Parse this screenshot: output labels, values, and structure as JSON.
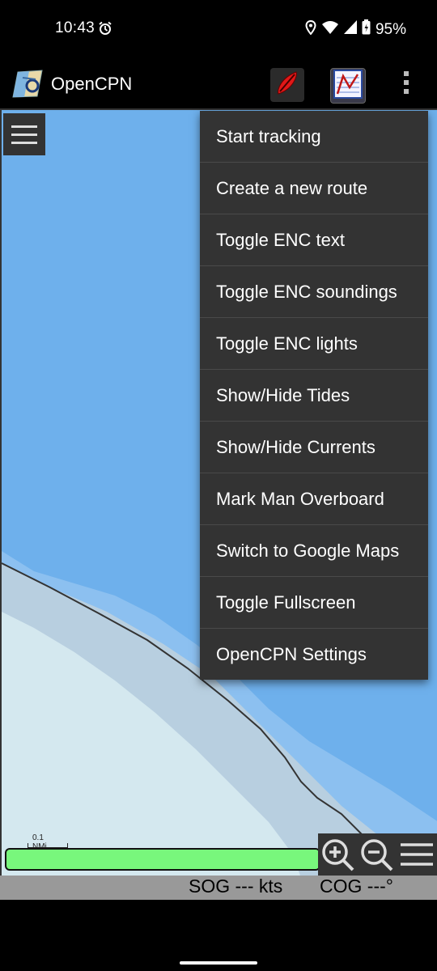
{
  "status_bar": {
    "time": "10:43",
    "battery": "95%"
  },
  "app_bar": {
    "title": "OpenCPN"
  },
  "menu": {
    "items": [
      "Start tracking",
      "Create a new route",
      "Toggle ENC text",
      "Toggle ENC soundings",
      "Toggle ENC lights",
      "Show/Hide Tides",
      "Show/Hide Currents",
      "Mark Man Overboard",
      "Switch to Google Maps",
      "Toggle Fullscreen",
      "OpenCPN Settings"
    ]
  },
  "map": {
    "scale_label": "0.1 NMi",
    "colors": {
      "deep_water": "#6eb0ec",
      "shallow": "#8cc0f0",
      "shoal": "#b8cfe0",
      "land": "#d4e8ef"
    }
  },
  "info_bar": {
    "sog": "SOG --- kts",
    "cog": "COG ---°"
  }
}
